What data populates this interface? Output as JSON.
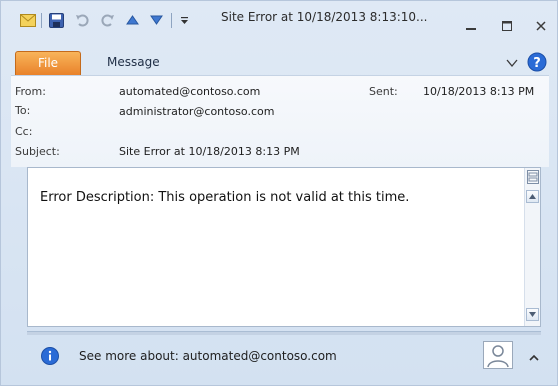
{
  "window": {
    "title": "Site Error at  10/18/2013 8:13:10..."
  },
  "ribbon": {
    "tabs": [
      {
        "label": "File"
      },
      {
        "label": "Message"
      }
    ]
  },
  "header": {
    "from_label": "From:",
    "from_value": "automated@contoso.com",
    "sent_label": "Sent:",
    "sent_value": "10/18/2013 8:13 PM",
    "to_label": "To:",
    "to_value": "administrator@contoso.com",
    "cc_label": "Cc:",
    "subject_label": "Subject:",
    "subject_value": "Site Error at  10/18/2013 8:13 PM"
  },
  "body": {
    "text": "Error Description: This operation is not valid at this time."
  },
  "people_pane": {
    "text": "See more about: automated@contoso.com"
  },
  "colors": {
    "file_tab": "#e9822a",
    "info_icon": "#2a6bd6",
    "help_icon": "#2a6bd6"
  }
}
